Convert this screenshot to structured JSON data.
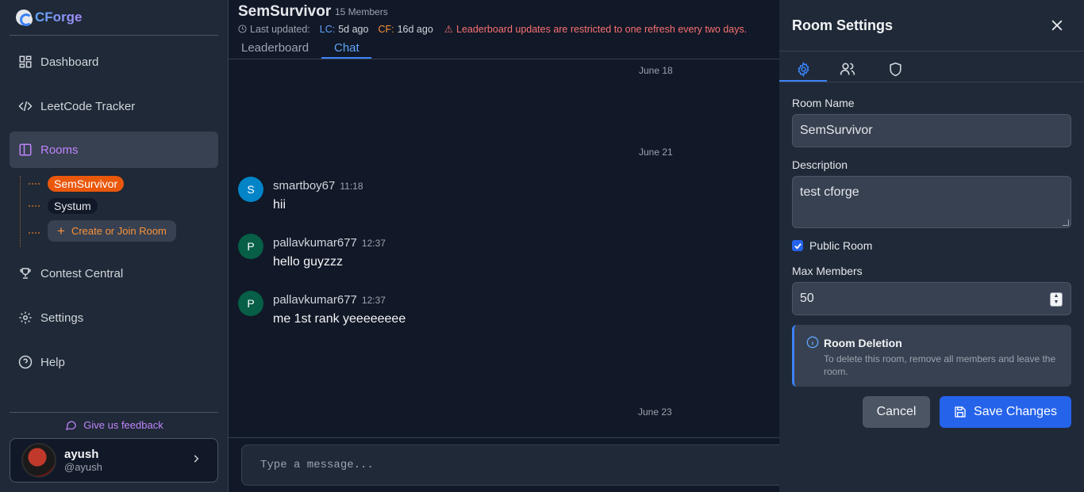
{
  "app": {
    "logo_text": "CForge"
  },
  "sidebar": {
    "items": [
      {
        "label": "Dashboard",
        "icon": "dashboard-icon"
      },
      {
        "label": "LeetCode Tracker",
        "icon": "code-icon"
      },
      {
        "label": "Rooms",
        "icon": "panel-icon"
      },
      {
        "label": "Contest Central",
        "icon": "trophy-icon"
      },
      {
        "label": "Settings",
        "icon": "gear-icon"
      },
      {
        "label": "Help",
        "icon": "help-icon"
      }
    ],
    "rooms": [
      "SemSurvivor",
      "Systum"
    ],
    "create_room_label": "Create or Join Room",
    "feedback_label": "Give us feedback",
    "user": {
      "name": "ayush",
      "handle": "@ayush"
    }
  },
  "room": {
    "title": "SemSurvivor",
    "members": "15 Members",
    "last_updated_label": "Last updated:",
    "lc_label": "LC:",
    "lc_value": "5d ago",
    "cf_label": "CF:",
    "cf_value": "16d ago",
    "warning": "Leaderboard updates are restricted to one refresh every two days.",
    "tabs": [
      "Leaderboard",
      "Chat"
    ]
  },
  "chat": {
    "dates": [
      "June 18",
      "June 21",
      "June 23"
    ],
    "messages": [
      {
        "initial": "S",
        "author": "smartboy67",
        "time": "11:18",
        "text": "hii"
      },
      {
        "initial": "P",
        "author": "pallavkumar677",
        "time": "12:37",
        "text": "hello guyzzz"
      },
      {
        "initial": "P",
        "author": "pallavkumar677",
        "time": "12:37",
        "text": "me 1st rank yeeeeeeee"
      }
    ],
    "composer_placeholder": "Type a message..."
  },
  "settings": {
    "title": "Room Settings",
    "name_label": "Room Name",
    "name_value": "SemSurvivor",
    "desc_label": "Description",
    "desc_value": "test cforge",
    "public_label": "Public Room",
    "public_checked": true,
    "max_label": "Max Members",
    "max_value": "50",
    "deletion_title": "Room Deletion",
    "deletion_text": "To delete this room, remove all members and leave the room.",
    "cancel_label": "Cancel",
    "save_label": "Save Changes"
  },
  "colors": {
    "accent": "#3b82f6",
    "active_room": "#ea580c",
    "rooms_active": "#c084fc",
    "avatar_s": "#0284c7",
    "avatar_p": "#065f46"
  }
}
